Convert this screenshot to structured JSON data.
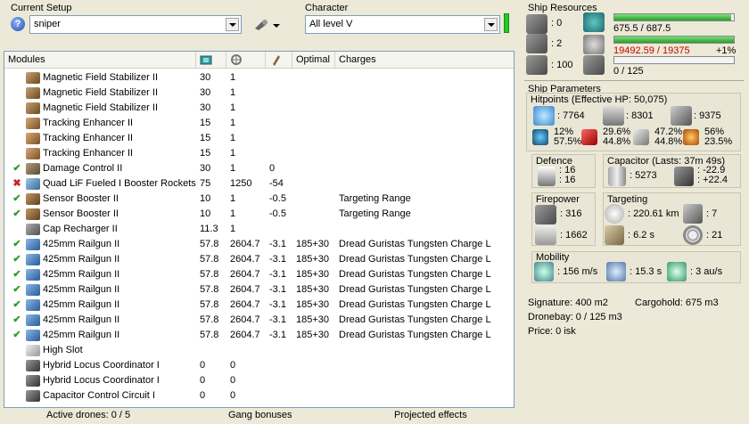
{
  "setup": {
    "label": "Current Setup",
    "value": "sniper"
  },
  "character": {
    "label": "Character",
    "value": "All level V"
  },
  "modules_table": {
    "headers": {
      "name": "Modules",
      "optimal": "Optimal",
      "charges": "Charges"
    },
    "rows": [
      {
        "state": "",
        "icon": "magnetic-field-stabilizer-icon",
        "name": "Magnetic Field Stabilizer II",
        "cpu": "30",
        "pg": "1",
        "cap": "",
        "optimal": "",
        "charges": ""
      },
      {
        "state": "",
        "icon": "magnetic-field-stabilizer-icon",
        "name": "Magnetic Field Stabilizer II",
        "cpu": "30",
        "pg": "1",
        "cap": "",
        "optimal": "",
        "charges": ""
      },
      {
        "state": "",
        "icon": "magnetic-field-stabilizer-icon",
        "name": "Magnetic Field Stabilizer II",
        "cpu": "30",
        "pg": "1",
        "cap": "",
        "optimal": "",
        "charges": ""
      },
      {
        "state": "",
        "icon": "tracking-enhancer-icon",
        "name": "Tracking Enhancer II",
        "cpu": "15",
        "pg": "1",
        "cap": "",
        "optimal": "",
        "charges": ""
      },
      {
        "state": "",
        "icon": "tracking-enhancer-icon",
        "name": "Tracking Enhancer II",
        "cpu": "15",
        "pg": "1",
        "cap": "",
        "optimal": "",
        "charges": ""
      },
      {
        "state": "",
        "icon": "tracking-enhancer-icon",
        "name": "Tracking Enhancer II",
        "cpu": "15",
        "pg": "1",
        "cap": "",
        "optimal": "",
        "charges": ""
      },
      {
        "state": "✔",
        "icon": "damage-control-icon",
        "name": "Damage Control II",
        "cpu": "30",
        "pg": "1",
        "cap": "0",
        "optimal": "",
        "charges": ""
      },
      {
        "state": "✖",
        "icon": "afterburner-icon",
        "name": "Quad LiF Fueled I Booster Rockets",
        "cpu": "75",
        "pg": "1250",
        "cap": "-54",
        "optimal": "",
        "charges": ""
      },
      {
        "state": "✔",
        "icon": "sensor-booster-icon",
        "name": "Sensor Booster II",
        "cpu": "10",
        "pg": "1",
        "cap": "-0.5",
        "optimal": "",
        "charges": "Targeting Range"
      },
      {
        "state": "✔",
        "icon": "sensor-booster-icon",
        "name": "Sensor Booster II",
        "cpu": "10",
        "pg": "1",
        "cap": "-0.5",
        "optimal": "",
        "charges": "Targeting Range"
      },
      {
        "state": "",
        "icon": "cap-recharger-icon",
        "name": "Cap Recharger II",
        "cpu": "11.3",
        "pg": "1",
        "cap": "",
        "optimal": "",
        "charges": ""
      },
      {
        "state": "✔",
        "icon": "railgun-icon",
        "name": "425mm Railgun II",
        "cpu": "57.8",
        "pg": "2604.7",
        "cap": "-3.1",
        "optimal": "185+30",
        "charges": "Dread Guristas Tungsten Charge L"
      },
      {
        "state": "✔",
        "icon": "railgun-icon",
        "name": "425mm Railgun II",
        "cpu": "57.8",
        "pg": "2604.7",
        "cap": "-3.1",
        "optimal": "185+30",
        "charges": "Dread Guristas Tungsten Charge L"
      },
      {
        "state": "✔",
        "icon": "railgun-icon",
        "name": "425mm Railgun II",
        "cpu": "57.8",
        "pg": "2604.7",
        "cap": "-3.1",
        "optimal": "185+30",
        "charges": "Dread Guristas Tungsten Charge L"
      },
      {
        "state": "✔",
        "icon": "railgun-icon",
        "name": "425mm Railgun II",
        "cpu": "57.8",
        "pg": "2604.7",
        "cap": "-3.1",
        "optimal": "185+30",
        "charges": "Dread Guristas Tungsten Charge L"
      },
      {
        "state": "✔",
        "icon": "railgun-icon",
        "name": "425mm Railgun II",
        "cpu": "57.8",
        "pg": "2604.7",
        "cap": "-3.1",
        "optimal": "185+30",
        "charges": "Dread Guristas Tungsten Charge L"
      },
      {
        "state": "✔",
        "icon": "railgun-icon",
        "name": "425mm Railgun II",
        "cpu": "57.8",
        "pg": "2604.7",
        "cap": "-3.1",
        "optimal": "185+30",
        "charges": "Dread Guristas Tungsten Charge L"
      },
      {
        "state": "✔",
        "icon": "railgun-icon",
        "name": "425mm Railgun II",
        "cpu": "57.8",
        "pg": "2604.7",
        "cap": "-3.1",
        "optimal": "185+30",
        "charges": "Dread Guristas Tungsten Charge L"
      },
      {
        "state": "",
        "icon": "high-slot-icon",
        "name": "High Slot",
        "cpu": "",
        "pg": "",
        "cap": "",
        "optimal": "",
        "charges": ""
      },
      {
        "state": "",
        "icon": "rig-icon",
        "name": "Hybrid Locus Coordinator I",
        "cpu": "0",
        "pg": "0",
        "cap": "",
        "optimal": "",
        "charges": ""
      },
      {
        "state": "",
        "icon": "rig-icon",
        "name": "Hybrid Locus Coordinator I",
        "cpu": "0",
        "pg": "0",
        "cap": "",
        "optimal": "",
        "charges": ""
      },
      {
        "state": "",
        "icon": "rig-icon",
        "name": "Capacitor Control Circuit I",
        "cpu": "0",
        "pg": "0",
        "cap": "",
        "optimal": "",
        "charges": ""
      }
    ]
  },
  "status": {
    "drones": "Active drones: 0 / 5",
    "gang": "Gang bonuses",
    "projected": "Projected effects"
  },
  "resources": {
    "title": "Ship Resources",
    "turrets": ": 0",
    "launchers": ": 2",
    "calibration": ": 100",
    "cpu": {
      "text": "675.5 / 687.5",
      "fraction": 0.98
    },
    "powergrid": {
      "text": "19492.59 / 19375",
      "extra": "+1%",
      "fraction": 1.0
    },
    "drone_bay": {
      "text": "0 / 125",
      "fraction": 0.0
    }
  },
  "params": {
    "title": "Ship Parameters",
    "hitpoints_title": "Hitpoints (Effective HP: 50,075)",
    "shield_hp": ": 7764",
    "armor_hp": ": 8301",
    "hull_hp": ": 9375",
    "resists": [
      {
        "a": "12%",
        "b": "57.5%"
      },
      {
        "a": "29.6%",
        "b": "44.8%"
      },
      {
        "a": "47.2%",
        "b": "44.8%"
      },
      {
        "a": "56%",
        "b": "23.5%"
      }
    ],
    "defence_title": "Defence",
    "defence_a": ": 16",
    "defence_b": ": 16",
    "capacitor_title": "Capacitor (Lasts: 37m 49s)",
    "cap_value": ": 5273",
    "cap_use": ": -22.9",
    "cap_recharge": ": +22.4",
    "firepower_title": "Firepower",
    "volley": ": 316",
    "dps": ": 1662",
    "targeting_title": "Targeting",
    "range": ": 220.61 km",
    "max_targets": ": 7",
    "lock_time": ": 6.2 s",
    "scan_res": ": 21",
    "mobility_title": "Mobility",
    "speed": ": 156 m/s",
    "align": ": 15.3 s",
    "warp": ": 3 au/s",
    "signature": "Signature: 400 m2",
    "cargohold": "Cargohold: 675 m3",
    "dronebay": "Dronebay: 0 / 125 m3",
    "price": "Price: 0 isk"
  },
  "colors": {
    "accent_green": "#22cc22",
    "overload_red": "#cc0000"
  }
}
